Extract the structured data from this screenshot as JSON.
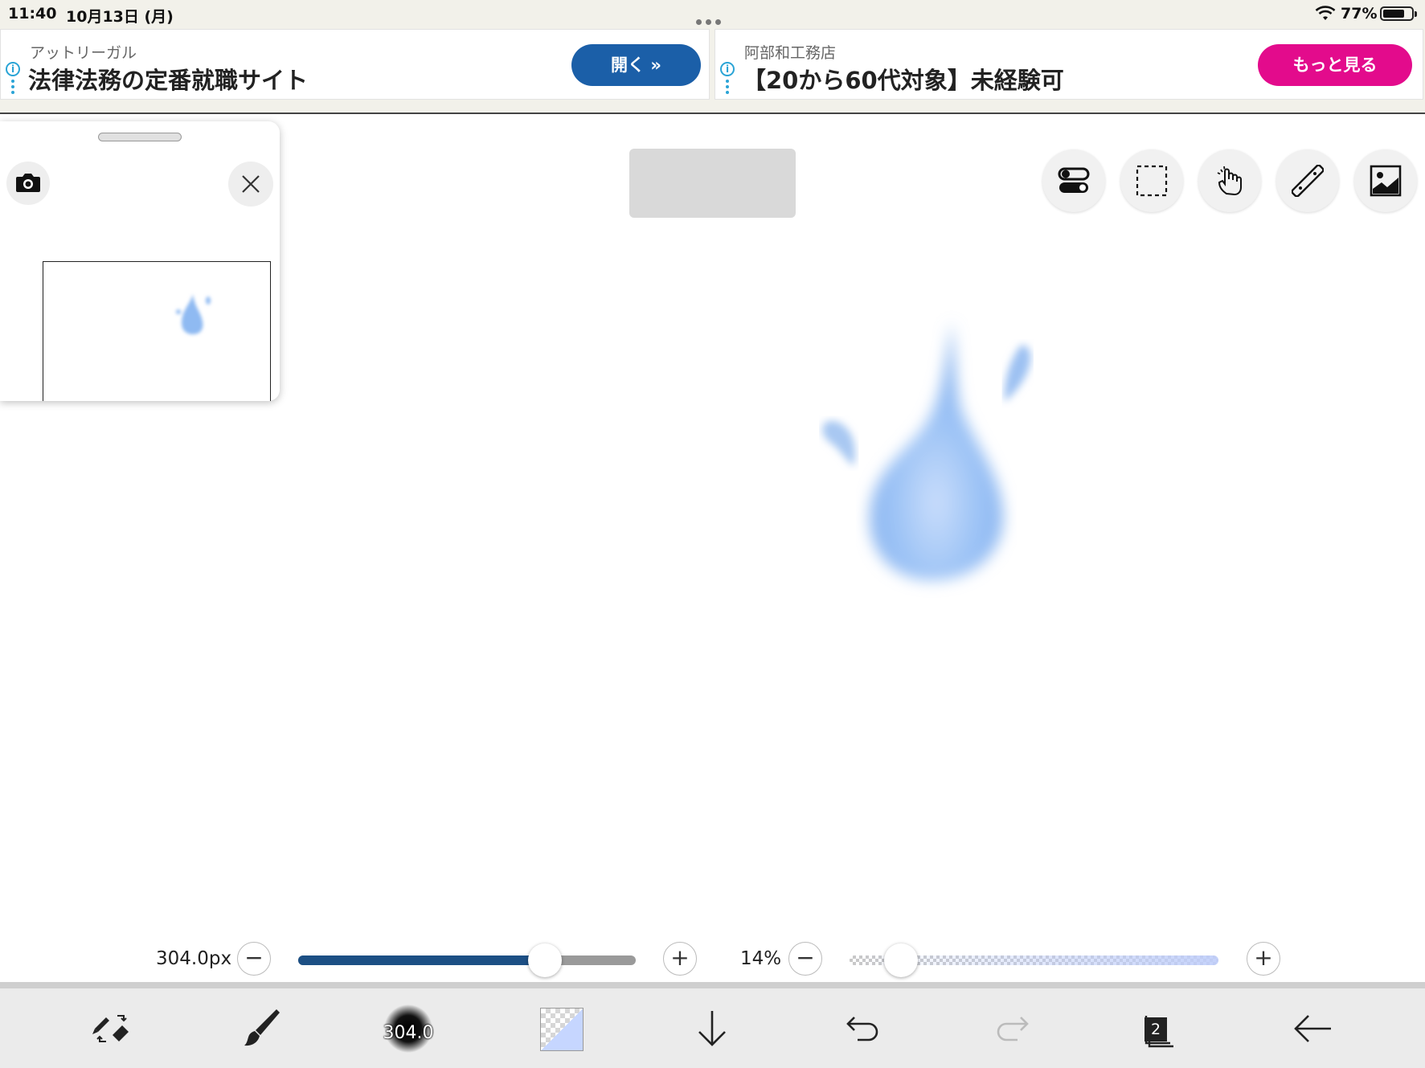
{
  "status_bar": {
    "time": "11:40",
    "date": "10月13日 (月)",
    "battery_percent": "77%",
    "battery_level": 0.77
  },
  "ads": [
    {
      "sponsor": "アットリーガル",
      "headline": "法律法務の定番就職サイト",
      "button_label": "開く  »",
      "button_color": "#1b5fa8"
    },
    {
      "sponsor": "阿部和工務店",
      "headline": "【20から60代対象】未経験可",
      "button_label": "もっと見る",
      "button_color": "#e30b8c"
    }
  ],
  "navigator": {
    "camera_icon": "camera-icon",
    "close_icon": "close-icon"
  },
  "top_tools": [
    {
      "name": "toggle-icon"
    },
    {
      "name": "selection-icon"
    },
    {
      "name": "hand-icon"
    },
    {
      "name": "ruler-icon"
    },
    {
      "name": "image-icon"
    }
  ],
  "brush_size": {
    "value_label": "304.0px",
    "level": 0.73
  },
  "opacity": {
    "value_label": "14%",
    "level": 0.14
  },
  "toolbar": {
    "brush_size_label": "304.0",
    "layer_count": "2",
    "color_accent": "#c6d6ff"
  },
  "colors": {
    "slider_fill": "#1c4f84",
    "drop_blue": "#8fbaf2"
  }
}
